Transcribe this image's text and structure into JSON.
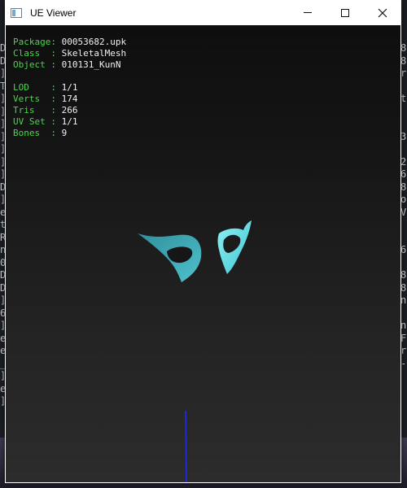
{
  "window": {
    "title": "UE Viewer",
    "controls": {
      "minimize": "—",
      "maximize": "☐",
      "close": "✕"
    }
  },
  "mesh_info": {
    "package": {
      "label": "Package:",
      "value": "00053682.upk"
    },
    "class": {
      "label": "Class  :",
      "value": "SkeletalMesh"
    },
    "object": {
      "label": "Object :",
      "value": "010131_KunN"
    },
    "lod": {
      "label": "LOD    :",
      "value": "1/1"
    },
    "verts": {
      "label": "Verts  :",
      "value": "174"
    },
    "tris": {
      "label": "Tris   :",
      "value": "266"
    },
    "uvset": {
      "label": "UV Set :",
      "value": "1/1"
    },
    "bones": {
      "label": "Bones  :",
      "value": "9"
    }
  },
  "background_console": {
    "left": "D\nD\n]\nT\n]\n]\n]\n]\n]\n]\n]\nD\n]\ne\nt\nR\nn\n0\nD\nD\n]\n6\n]\ne\ne\n_\n]\ne\n]",
    "right": "8\n8\nr\n\nt\n\n\n3\n\n2\n6\n8\no\nV\n\n\n6\n\n8\n8\nn\n\nn\nF\nr\n-"
  },
  "colors": {
    "label": "#4ad64a",
    "value": "#f0f0f0",
    "mesh": "#3fb7c4",
    "bone_line": "#1e2bd0"
  }
}
